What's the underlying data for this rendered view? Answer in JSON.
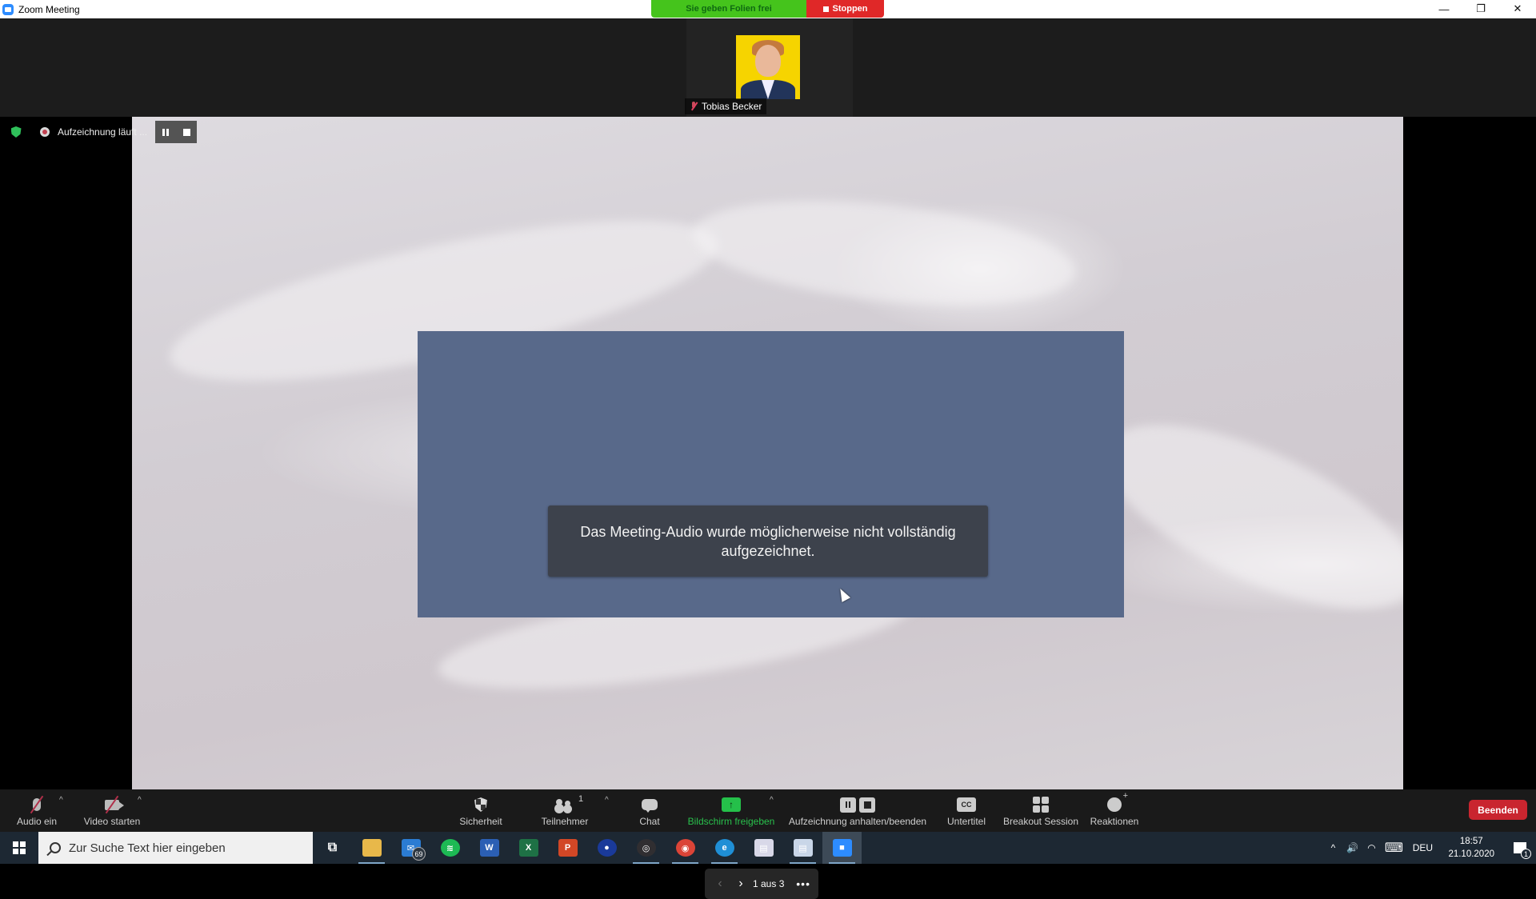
{
  "window": {
    "title": "Zoom Meeting",
    "controls": {
      "minimize": "—",
      "restore": "❐",
      "close": "✕"
    }
  },
  "share_banner": {
    "status_label": "Sie geben Folien frei",
    "stop_label": "Stoppen",
    "status_color": "#45c41c",
    "stop_color": "#e02828"
  },
  "participant_thumbnail": {
    "name": "Tobias Becker",
    "muted": true,
    "avatar_background": "#f6d400"
  },
  "recording_indicator": {
    "label": "Aufzeichnung läuft ...",
    "pause_icon": "pause-icon",
    "stop_icon": "stop-icon"
  },
  "slide": {
    "toast_message": "Das Meeting-Audio wurde möglicherweise nicht vollständig aufgezeichnet.",
    "box_color": "#58698a"
  },
  "slide_nav": {
    "prev": "‹",
    "next": "›",
    "page_label": "1 aus 3",
    "more": "•••"
  },
  "toolbar": {
    "audio": {
      "label": "Audio ein",
      "icon": "mic-muted-icon"
    },
    "video": {
      "label": "Video starten",
      "icon": "video-off-icon"
    },
    "security": {
      "label": "Sicherheit",
      "icon": "shield-icon"
    },
    "participants": {
      "label": "Teilnehmer",
      "count": "1",
      "icon": "participants-icon"
    },
    "chat": {
      "label": "Chat",
      "icon": "chat-icon"
    },
    "share_screen": {
      "label": "Bildschirm freigeben",
      "icon_glyph": "↑",
      "color": "#29c04c"
    },
    "recording": {
      "label": "Aufzeichnung anhalten/beenden"
    },
    "captions": {
      "label": "Untertitel",
      "icon_text": "CC"
    },
    "breakout": {
      "label": "Breakout Session"
    },
    "reactions": {
      "label": "Reaktionen"
    },
    "caret": "^",
    "end": {
      "label": "Beenden",
      "color": "#c9252f"
    }
  },
  "taskbar": {
    "search_placeholder": "Zur Suche Text hier eingeben",
    "apps": [
      {
        "name": "task-view",
        "glyph": "⧉",
        "color": "transparent"
      },
      {
        "name": "file-explorer",
        "glyph": "",
        "color": "#e8b84a"
      },
      {
        "name": "mail",
        "glyph": "✉",
        "color": "#2b7cd3",
        "badge": "69"
      },
      {
        "name": "spotify",
        "glyph": "≋",
        "color": "#1db954"
      },
      {
        "name": "word",
        "glyph": "W",
        "color": "#2b5fb4"
      },
      {
        "name": "excel",
        "glyph": "X",
        "color": "#1e7145"
      },
      {
        "name": "powerpoint",
        "glyph": "P",
        "color": "#d24726"
      },
      {
        "name": "app-orange",
        "glyph": "●",
        "color": "#1a3a9a"
      },
      {
        "name": "obs",
        "glyph": "◎",
        "color": "#302e31"
      },
      {
        "name": "chrome",
        "glyph": "◉",
        "color": "#db4437"
      },
      {
        "name": "edge",
        "glyph": "e",
        "color": "#1f8fd6"
      },
      {
        "name": "app-doc1",
        "glyph": "▤",
        "color": "#d8d8e8"
      },
      {
        "name": "app-doc2",
        "glyph": "▤",
        "color": "#c9d6e8"
      },
      {
        "name": "zoom",
        "glyph": "■",
        "color": "#2d8cff",
        "active": true
      }
    ],
    "tray": {
      "chevron": "^",
      "volume": "🔊",
      "wifi": "◠",
      "keyboard": "⌨",
      "language": "DEU",
      "time": "18:57",
      "date": "21.10.2020",
      "notifications": "1"
    }
  }
}
